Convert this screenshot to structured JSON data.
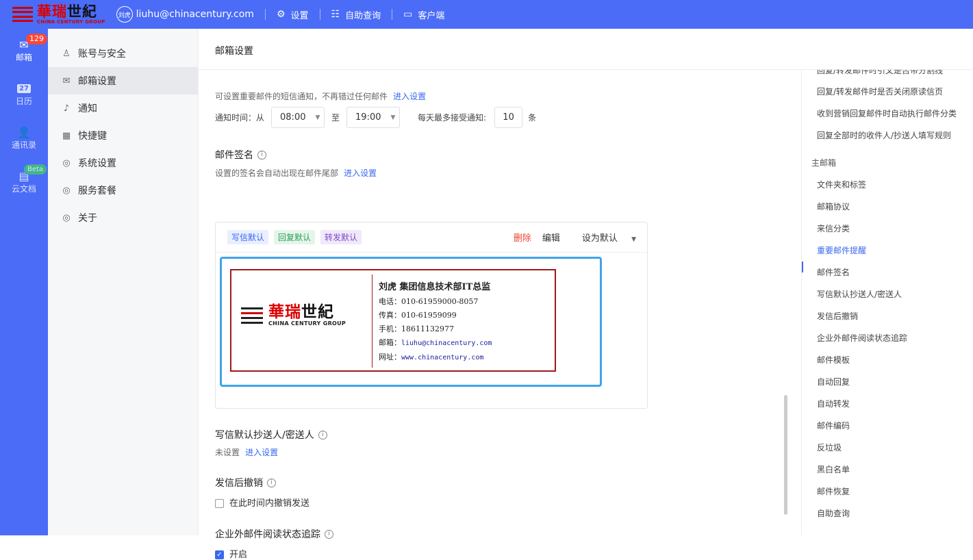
{
  "topbar": {
    "logo_cn_red": "華瑞",
    "logo_cn_black": "世紀",
    "logo_en": "CHINA CENTURY GROUP",
    "avatar_text": "刘虎",
    "email": "liuhu@chinacentury.com",
    "items": [
      {
        "label": "设置",
        "icon": "gear-icon"
      },
      {
        "label": "自助查询",
        "icon": "query-icon"
      },
      {
        "label": "客户端",
        "icon": "monitor-icon"
      }
    ]
  },
  "appnav": {
    "items": [
      {
        "label": "邮箱",
        "icon": "mail-icon",
        "badge": "129"
      },
      {
        "label": "日历",
        "icon": "calendar-icon",
        "day": "27"
      },
      {
        "label": "通讯录",
        "icon": "contacts-icon"
      },
      {
        "label": "云文档",
        "icon": "cloud-doc-icon",
        "badge": "Beta"
      }
    ]
  },
  "setnav": {
    "items": [
      {
        "label": "账号与安全",
        "icon": "user-icon"
      },
      {
        "label": "邮箱设置",
        "icon": "mail-outline-icon"
      },
      {
        "label": "通知",
        "icon": "bell-icon"
      },
      {
        "label": "快捷键",
        "icon": "keyboard-icon"
      },
      {
        "label": "系统设置",
        "icon": "gear-icon"
      },
      {
        "label": "服务套餐",
        "icon": "package-icon"
      },
      {
        "label": "关于",
        "icon": "info-gear-icon"
      }
    ],
    "active_index": 1
  },
  "page": {
    "title": "邮箱设置",
    "sms_note": "可设置重要邮件的短信通知，不再错过任何邮件",
    "sms_link": "进入设置",
    "notify_label": "通知时间：从",
    "notify_from": "08:00",
    "notify_to_label": "至",
    "notify_to": "19:00",
    "daily_label": "每天最多接受通知:",
    "daily_value": "10",
    "daily_unit": "条",
    "signature": {
      "title": "邮件签名",
      "desc": "设置的签名会自动出现在邮件尾部",
      "desc_link": "进入设置",
      "tags": [
        "写信默认",
        "回复默认",
        "转发默认"
      ],
      "actions": {
        "delete": "删除",
        "edit": "编辑",
        "set_default": "设为默认"
      },
      "card": {
        "logo_cn_red": "華瑞",
        "logo_cn_black": "世紀",
        "logo_en": "CHINA CENTURY GROUP",
        "name": "刘虎 集团信息技术部IT总监",
        "phone": "电话：010-61959000-8057",
        "fax": "传真：010-61959099",
        "mobile": "手机：18611132977",
        "email_label": "邮箱：",
        "email": "liuhu@chinacentury.com",
        "site_label": "网址：",
        "site": "www.chinacentury.com"
      }
    },
    "cc": {
      "title": "写信默认抄送人/密送人",
      "status": "未设置",
      "link": "进入设置"
    },
    "recall": {
      "title": "发信后撤销",
      "checkbox_label": "在此时间内撤销发送",
      "checked": false
    },
    "tracking": {
      "title": "企业外邮件阅读状态追踪",
      "checkbox_label": "开启",
      "checked": true
    }
  },
  "anchors": {
    "items": [
      {
        "label": "回复/转发邮件时引文是否带分割线",
        "group": false
      },
      {
        "label": "回复/转发邮件时是否关闭原读信页",
        "group": false
      },
      {
        "label": "收到营销回复邮件时自动执行邮件分类",
        "group": false
      },
      {
        "label": "回复全部时的收件人/抄送人填写规则",
        "group": false
      },
      {
        "label": "主邮箱",
        "group": true
      },
      {
        "label": "文件夹和标签",
        "group": false
      },
      {
        "label": "邮箱协议",
        "group": false
      },
      {
        "label": "来信分类",
        "group": false
      },
      {
        "label": "重要邮件提醒",
        "group": false,
        "active": true
      },
      {
        "label": "邮件签名",
        "group": false
      },
      {
        "label": "写信默认抄送人/密送人",
        "group": false
      },
      {
        "label": "发信后撤销",
        "group": false
      },
      {
        "label": "企业外邮件阅读状态追踪",
        "group": false
      },
      {
        "label": "邮件模板",
        "group": false
      },
      {
        "label": "自动回复",
        "group": false
      },
      {
        "label": "自动转发",
        "group": false
      },
      {
        "label": "邮件编码",
        "group": false
      },
      {
        "label": "反垃圾",
        "group": false
      },
      {
        "label": "黑白名单",
        "group": false
      },
      {
        "label": "邮件恢复",
        "group": false
      },
      {
        "label": "自助查询",
        "group": false
      }
    ]
  },
  "colors": {
    "accent": "#4a6cf7",
    "link": "#3a68f0",
    "danger": "#f0442f",
    "brand_red": "#c00000"
  }
}
